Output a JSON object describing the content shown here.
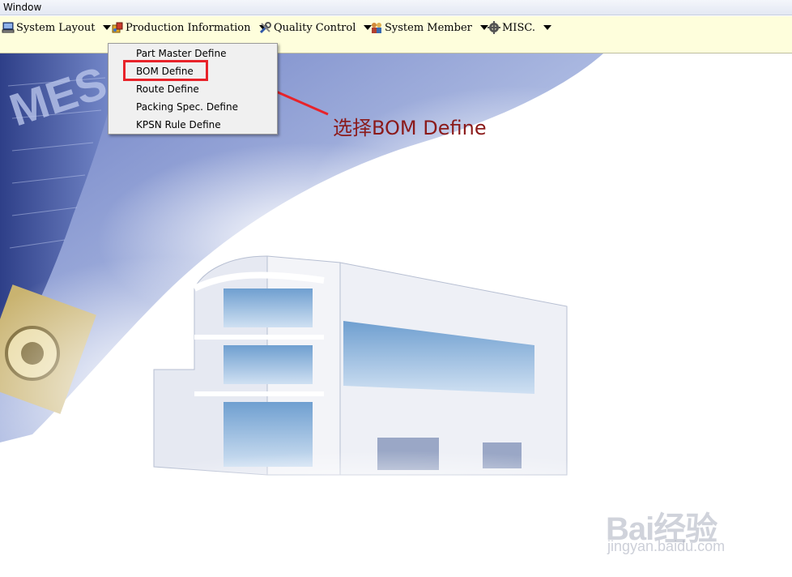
{
  "window": {
    "title": "Window"
  },
  "menubar": {
    "items": [
      {
        "label": "System Layout",
        "icon": "computer-icon"
      },
      {
        "label": "Production Information",
        "icon": "box-icon"
      },
      {
        "label": "Quality Control",
        "icon": "tools-icon"
      },
      {
        "label": "System Member",
        "icon": "users-icon"
      },
      {
        "label": "MISC.",
        "icon": "gear-icon"
      }
    ]
  },
  "dropdown": {
    "parent": "Production Information",
    "items": [
      {
        "label": "Part Master Define"
      },
      {
        "label": "BOM Define",
        "highlighted": true
      },
      {
        "label": "Route Define"
      },
      {
        "label": "Packing Spec. Define"
      },
      {
        "label": "KPSN Rule Define"
      }
    ]
  },
  "background": {
    "logo_text": "MES"
  },
  "annotation": {
    "text": "选择BOM Define",
    "color": "#8b1a1a",
    "highlight_color": "#e8232a"
  },
  "watermark": {
    "logo": "Bai经验",
    "url": "jingyan.baidu.com"
  }
}
